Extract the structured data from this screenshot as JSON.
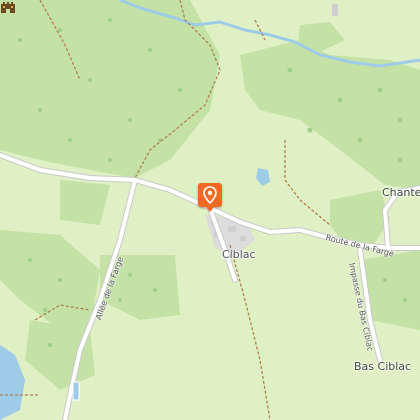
{
  "map": {
    "place_labels": {
      "ciblac": "Ciblac",
      "bas_ciblac": "Bas Ciblac",
      "chanteclair_partial": "Chantec"
    },
    "road_labels": {
      "route_de_la_farge": "Route de la Farge",
      "allee_de_la_farge": "Allée de la Farge",
      "impasse_du_bas_ciblac": "Impasse du Bas Ciblac"
    },
    "markers": [
      {
        "name": "location-pin",
        "icon": "map-pin-icon",
        "color": "#f26a21"
      }
    ],
    "pois": [
      {
        "name": "castle",
        "icon": "castle-icon",
        "color": "#6b4a1e"
      }
    ],
    "colors": {
      "land": "#dff0c4",
      "forest": "#c4e2a6",
      "water": "#9ecce8",
      "road": "#ffffff",
      "path": "#b08050",
      "built": "#dcdcdc"
    }
  }
}
